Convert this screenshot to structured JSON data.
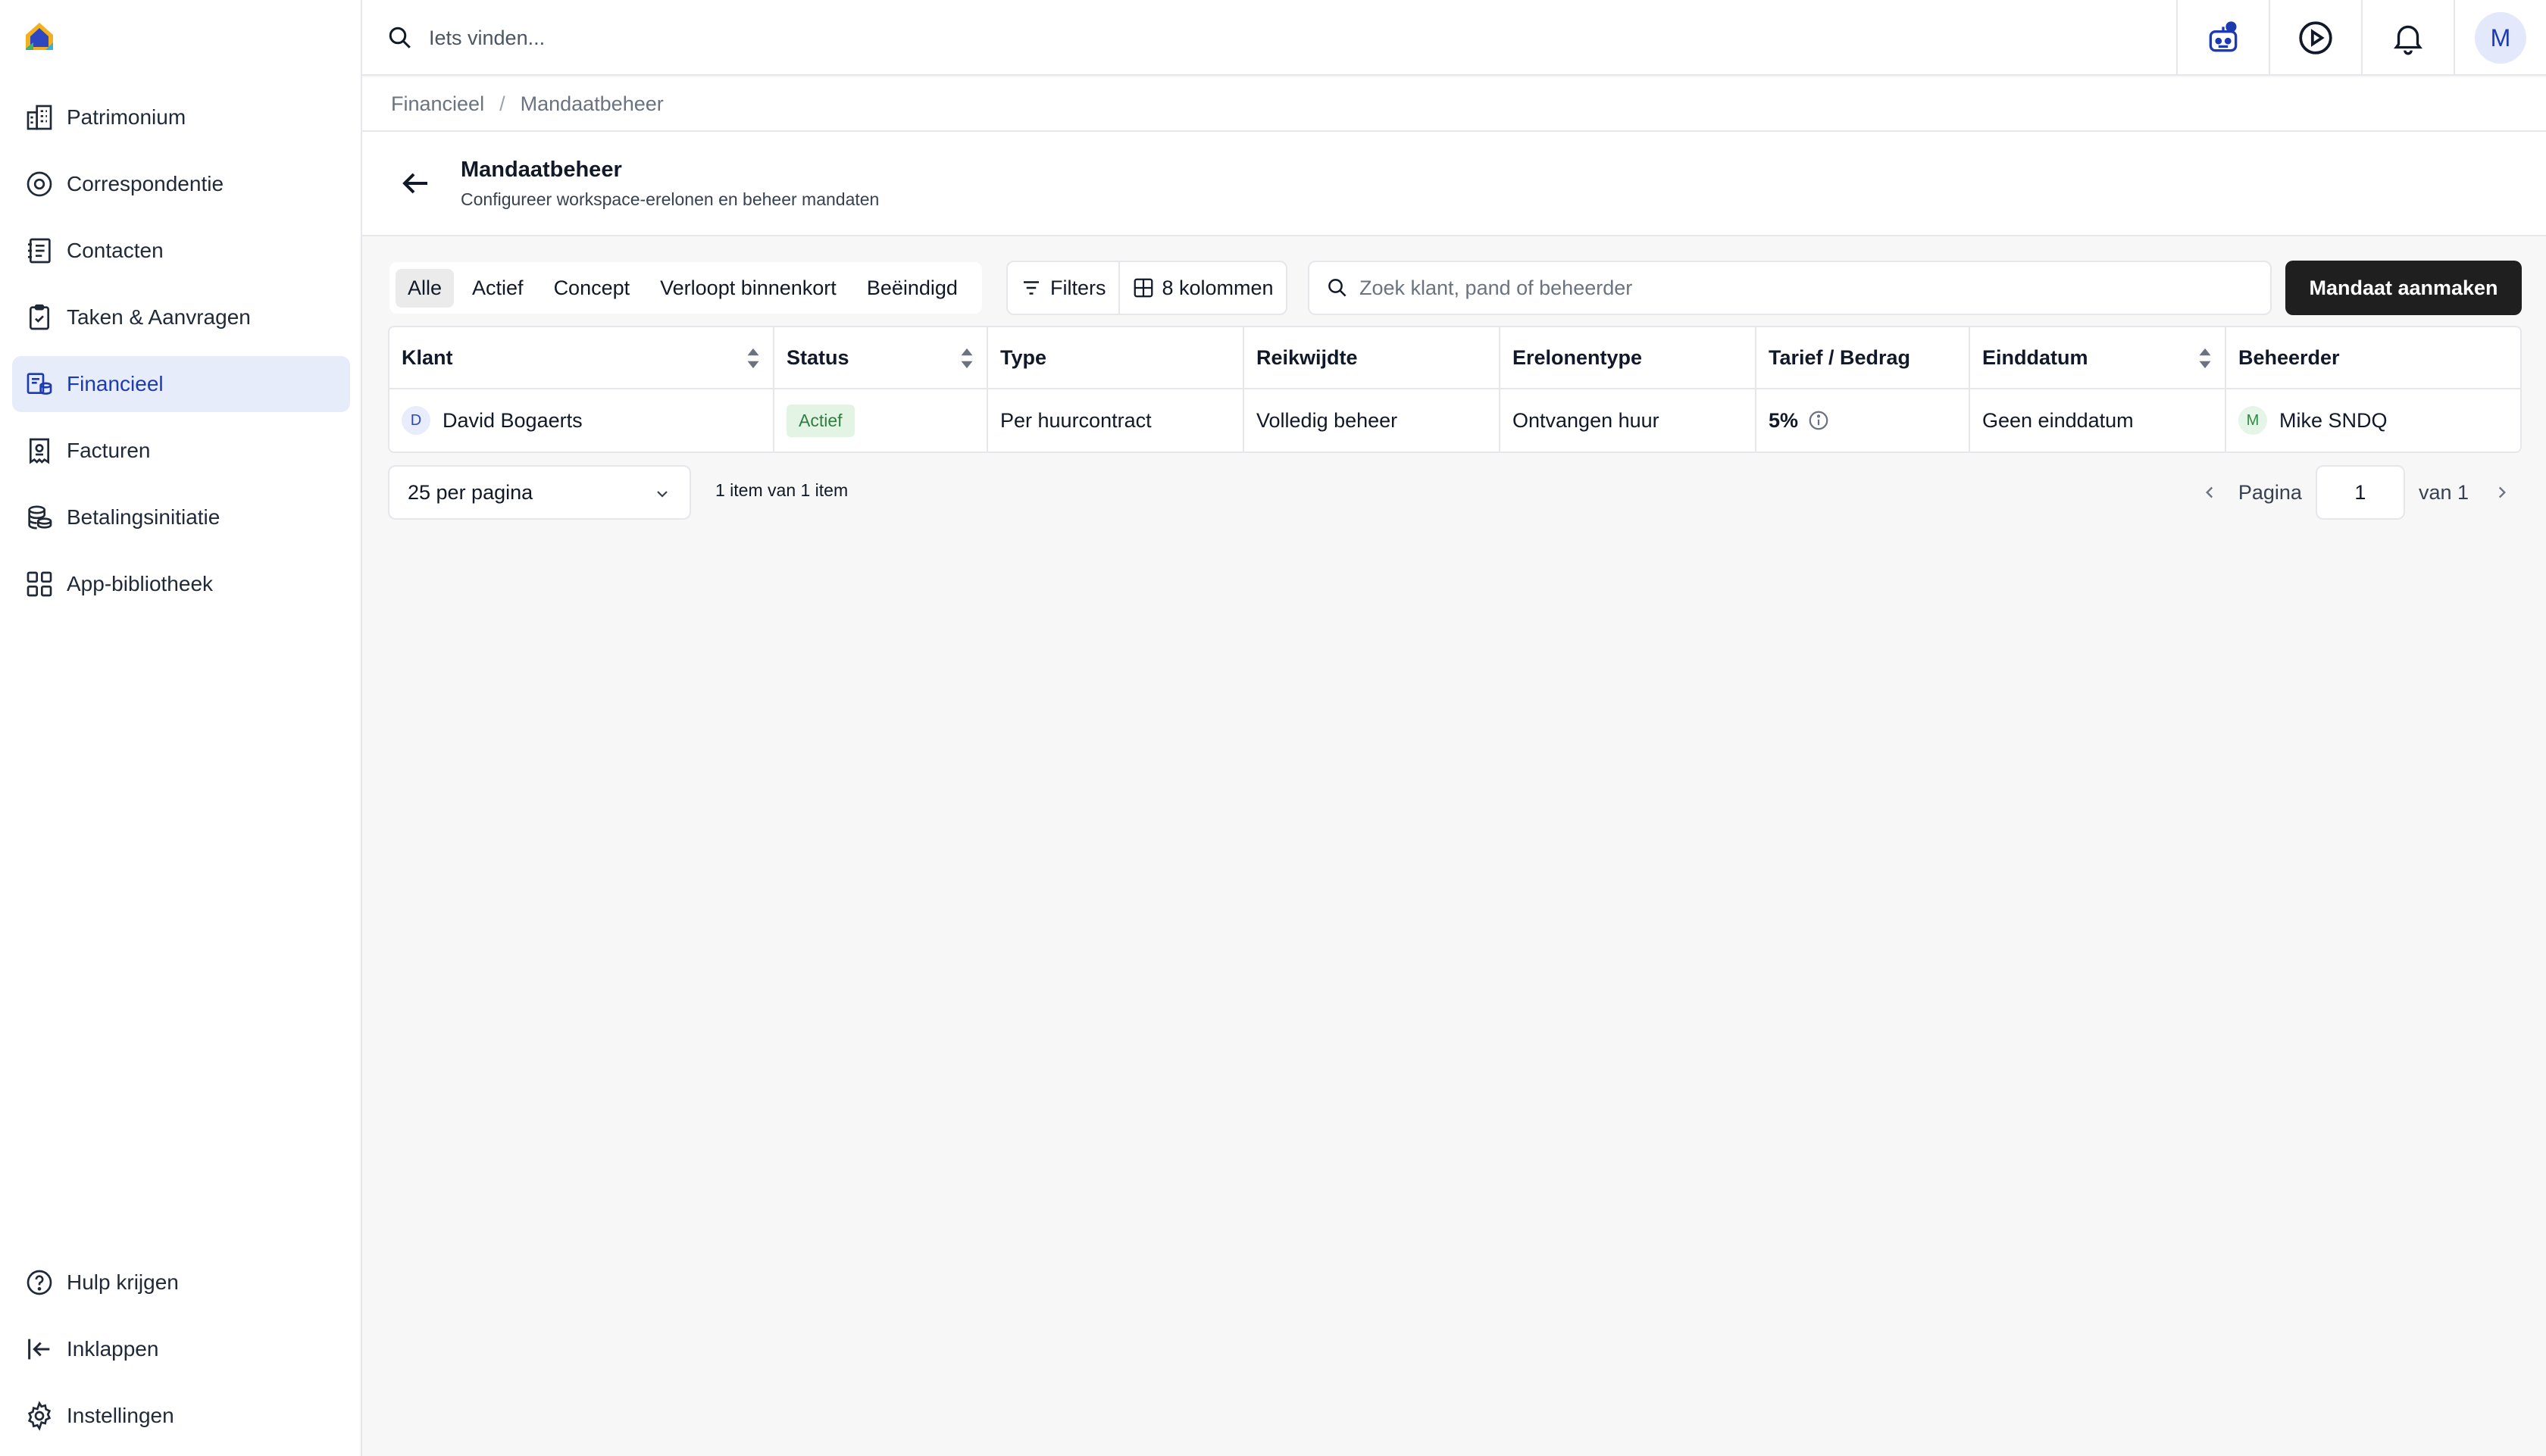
{
  "app": {
    "logo_icon": "house-logo-icon"
  },
  "sidebar": {
    "items": [
      {
        "label": "Patrimonium",
        "icon": "building-icon",
        "active": false
      },
      {
        "label": "Correspondentie",
        "icon": "at-sign-icon",
        "active": false
      },
      {
        "label": "Contacten",
        "icon": "contact-book-icon",
        "active": false
      },
      {
        "label": "Taken & Aanvragen",
        "icon": "clipboard-check-icon",
        "active": false
      },
      {
        "label": "Financieel",
        "icon": "finance-icon",
        "active": true
      },
      {
        "label": "Facturen",
        "icon": "receipt-icon",
        "active": false
      },
      {
        "label": "Betalingsinitiatie",
        "icon": "coins-icon",
        "active": false
      },
      {
        "label": "App-bibliotheek",
        "icon": "grid-icon",
        "active": false
      }
    ],
    "bottom": [
      {
        "label": "Hulp krijgen",
        "icon": "help-circle-icon"
      },
      {
        "label": "Inklappen",
        "icon": "collapse-icon"
      },
      {
        "label": "Instellingen",
        "icon": "gear-icon"
      }
    ],
    "active_color": "#1d3bb0",
    "active_bg": "#e7ecfb"
  },
  "topbar": {
    "search_placeholder": "Iets vinden...",
    "avatar_initial": "M"
  },
  "breadcrumb": {
    "parent": "Financieel",
    "separator": "/",
    "current": "Mandaatbeheer"
  },
  "header": {
    "title": "Mandaatbeheer",
    "subtitle": "Configureer workspace-erelonen en beheer mandaten"
  },
  "toolbar": {
    "tabs": [
      {
        "label": "Alle",
        "active": true
      },
      {
        "label": "Actief",
        "active": false
      },
      {
        "label": "Concept",
        "active": false
      },
      {
        "label": "Verloopt binnenkort",
        "active": false
      },
      {
        "label": "Beëindigd",
        "active": false
      }
    ],
    "filters_label": "Filters",
    "columns_label": "8 kolommen",
    "search_placeholder": "Zoek klant, pand of beheerder",
    "create_label": "Mandaat aanmaken"
  },
  "table": {
    "columns": [
      "Klant",
      "Status",
      "Type",
      "Reikwijdte",
      "Erelonentype",
      "Tarief / Bedrag",
      "Einddatum",
      "Beheerder"
    ],
    "rows": [
      {
        "klant_initial": "D",
        "klant": "David Bogaerts",
        "status": "Actief",
        "type": "Per huurcontract",
        "reikwijdte": "Volledig beheer",
        "erelonentype": "Ontvangen huur",
        "tarief": "5%",
        "einddatum": "Geen einddatum",
        "beheerder_initial": "M",
        "beheerder": "Mike SNDQ"
      }
    ]
  },
  "pagination": {
    "per_page": "25 per pagina",
    "count": "1 item van 1 item",
    "page_label": "Pagina",
    "page": "1",
    "of_label": "van 1"
  },
  "colors": {
    "primary_button": "#1f1f1f",
    "status_badge_bg": "#e3f4e5",
    "status_badge_text": "#2f7d3f"
  }
}
